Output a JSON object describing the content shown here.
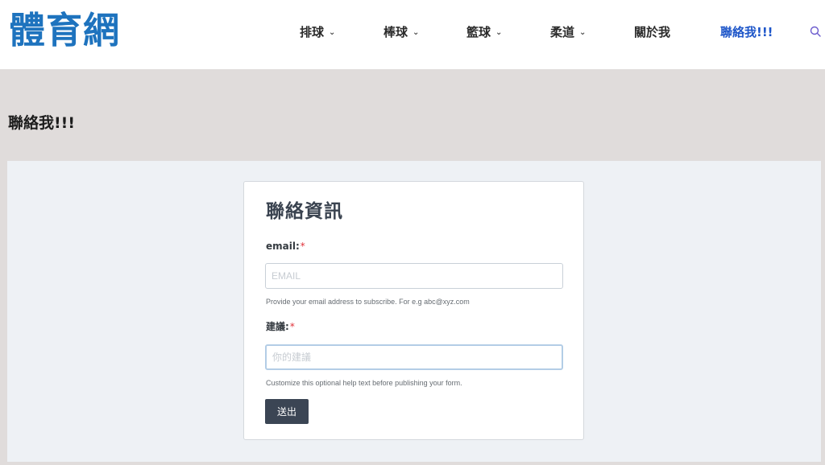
{
  "site": {
    "logo": "體育網"
  },
  "nav": {
    "items": [
      {
        "label": "排球",
        "chevron": "⌄"
      },
      {
        "label": "棒球",
        "chevron": "⌄"
      },
      {
        "label": "籃球",
        "chevron": "⌄"
      },
      {
        "label": "柔道",
        "chevron": "⌄"
      },
      {
        "label": "關於我"
      },
      {
        "label": "聯絡我!!!",
        "active": true
      }
    ],
    "search_icon": "search-icon"
  },
  "page": {
    "title": "聯絡我!!!"
  },
  "form": {
    "title": "聯絡資訊",
    "email": {
      "label": "email:",
      "required_mark": "*",
      "placeholder": "EMAIL",
      "help": "Provide your email address to subscribe. For e.g abc@xyz.com"
    },
    "suggestion": {
      "label": "建議:",
      "required_mark": "*",
      "placeholder": "你的建議",
      "help": "Customize this optional help text before publishing your form."
    },
    "submit_label": "送出"
  },
  "colors": {
    "brand": "#1e73be",
    "active_nav": "#1e56c9",
    "button": "#3b4554",
    "required": "#e0323a"
  }
}
